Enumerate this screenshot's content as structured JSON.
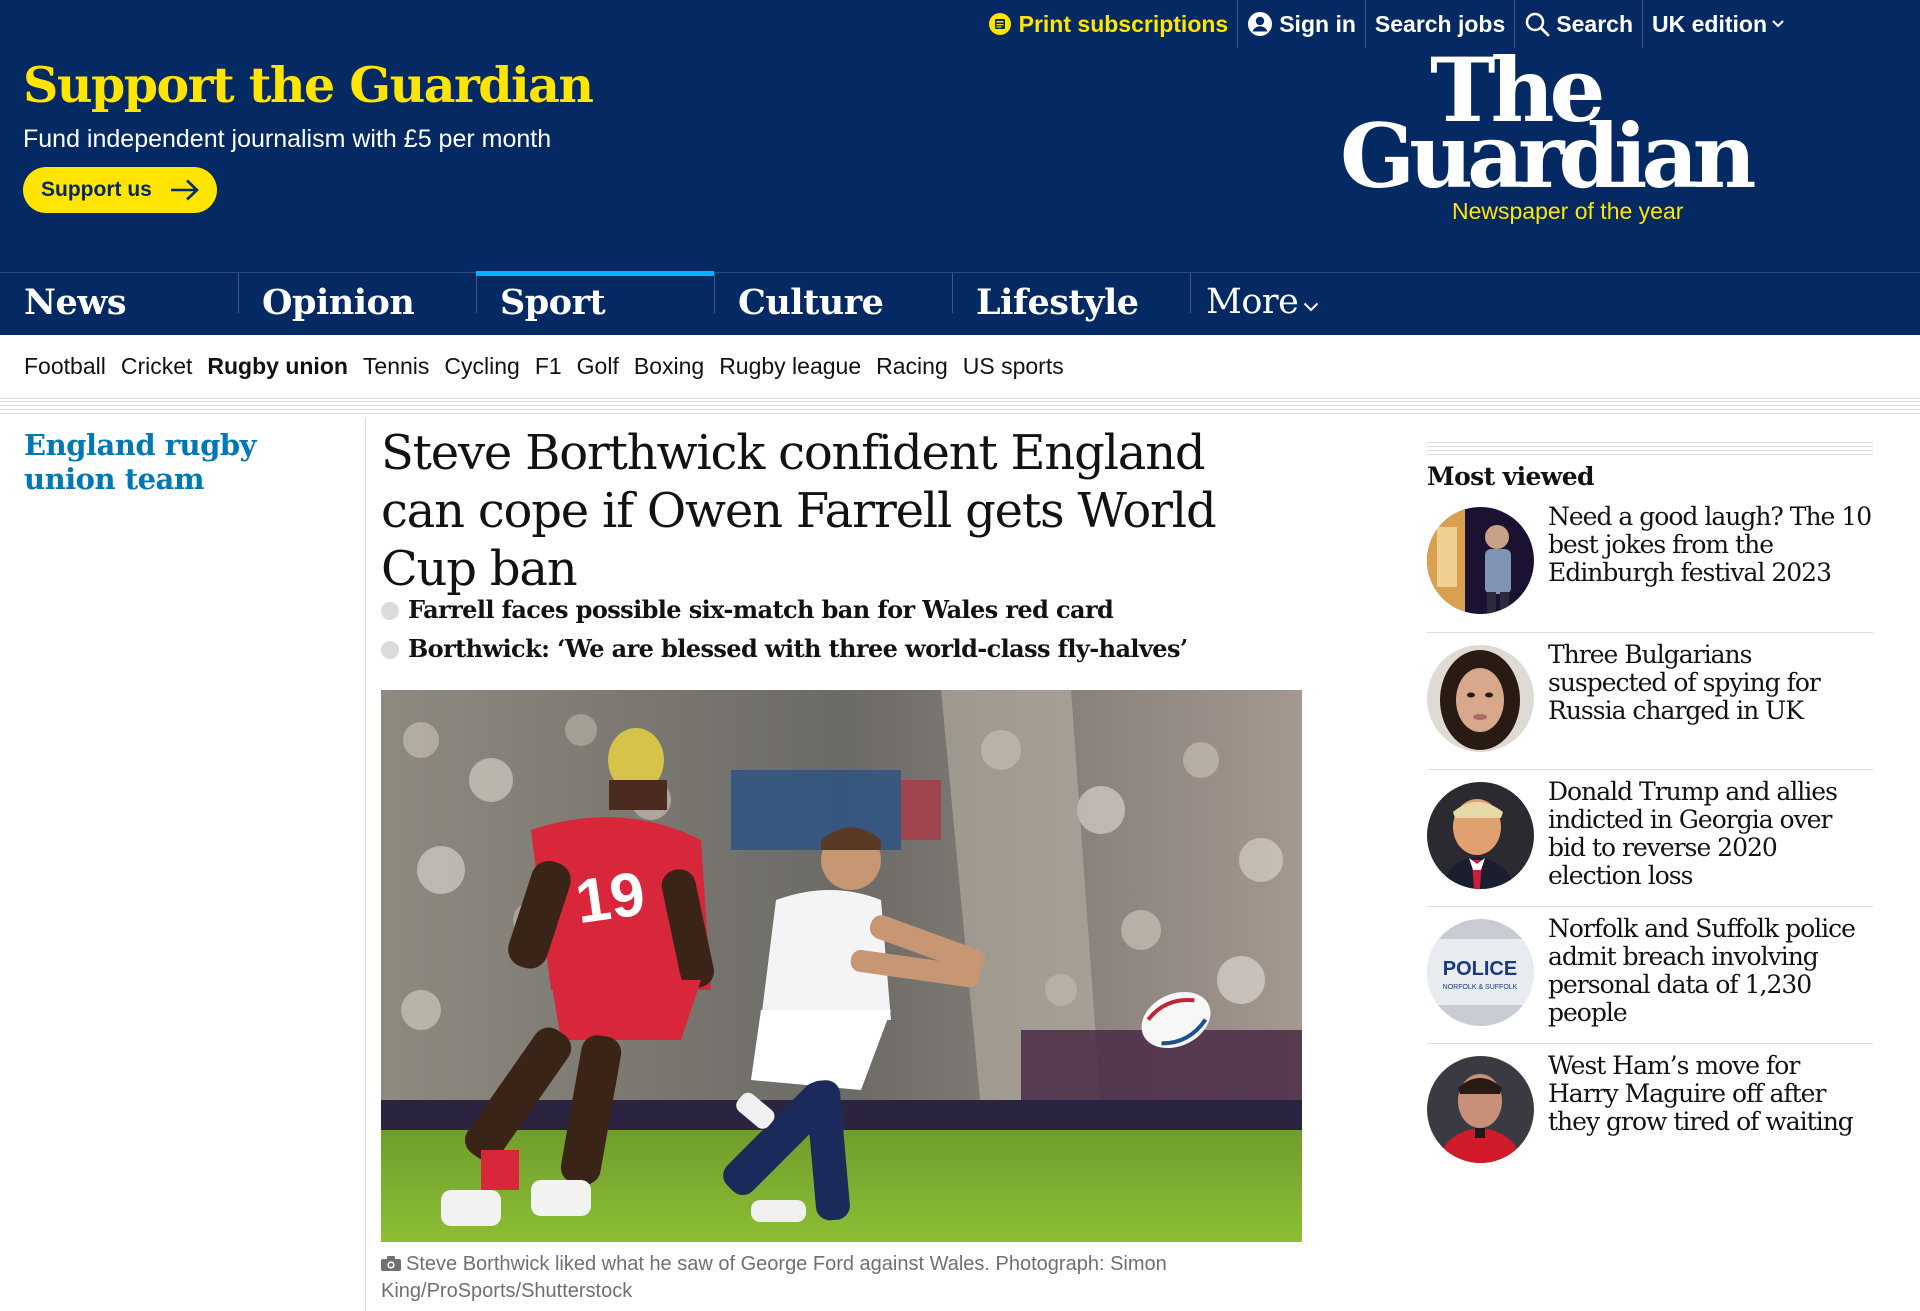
{
  "topbar": {
    "print_subscriptions": "Print subscriptions",
    "sign_in": "Sign in",
    "search_jobs": "Search jobs",
    "search": "Search",
    "edition": "UK edition"
  },
  "support": {
    "title": "Support the Guardian",
    "subtitle": "Fund independent journalism with £5 per month",
    "button": "Support us"
  },
  "logo": {
    "line1": "The",
    "line2": "Guardian",
    "tagline": "Newspaper of the year"
  },
  "pillars": [
    {
      "label": "News"
    },
    {
      "label": "Opinion"
    },
    {
      "label": "Sport",
      "active": true
    },
    {
      "label": "Culture"
    },
    {
      "label": "Lifestyle"
    },
    {
      "label": "More"
    }
  ],
  "subnav": [
    "Football",
    "Cricket",
    "Rugby union",
    "Tennis",
    "Cycling",
    "F1",
    "Golf",
    "Boxing",
    "Rugby league",
    "Racing",
    "US sports"
  ],
  "subnav_active": "Rugby union",
  "series": "England rugby union team",
  "article": {
    "headline": "Steve Borthwick confident England can cope if Owen Farrell gets World Cup ban",
    "standfirst": [
      "Farrell faces possible six-match ban for Wales red card",
      "Borthwick: ‘We are blessed with three world-class fly-halves’"
    ],
    "caption": "Steve Borthwick liked what he saw of George Ford against Wales. Photograph: Simon King/ProSports/Shutterstock"
  },
  "most_viewed": {
    "title": "Most viewed",
    "items": [
      "Need a good laugh? The 10 best jokes from the Edinburgh festival 2023",
      "Three Bulgarians suspected of spying for Russia charged in UK",
      "Donald Trump and allies indicted in Georgia over bid to reverse 2020 election loss",
      "Norfolk and Suffolk police admit breach involving personal data of 1,230 people",
      "West Ham’s move for Harry Maguire off after they grow tired of waiting"
    ]
  },
  "photo_text": {
    "jersey_number": "19",
    "police_sign": "POLICE",
    "police_sign_sub": "NORFOLK & SUFFOLK"
  },
  "colors": {
    "brand_blue": "#052962",
    "brand_yellow": "#ffe500",
    "sport_accent": "#00b2ff",
    "series_blue": "#0077b6"
  }
}
